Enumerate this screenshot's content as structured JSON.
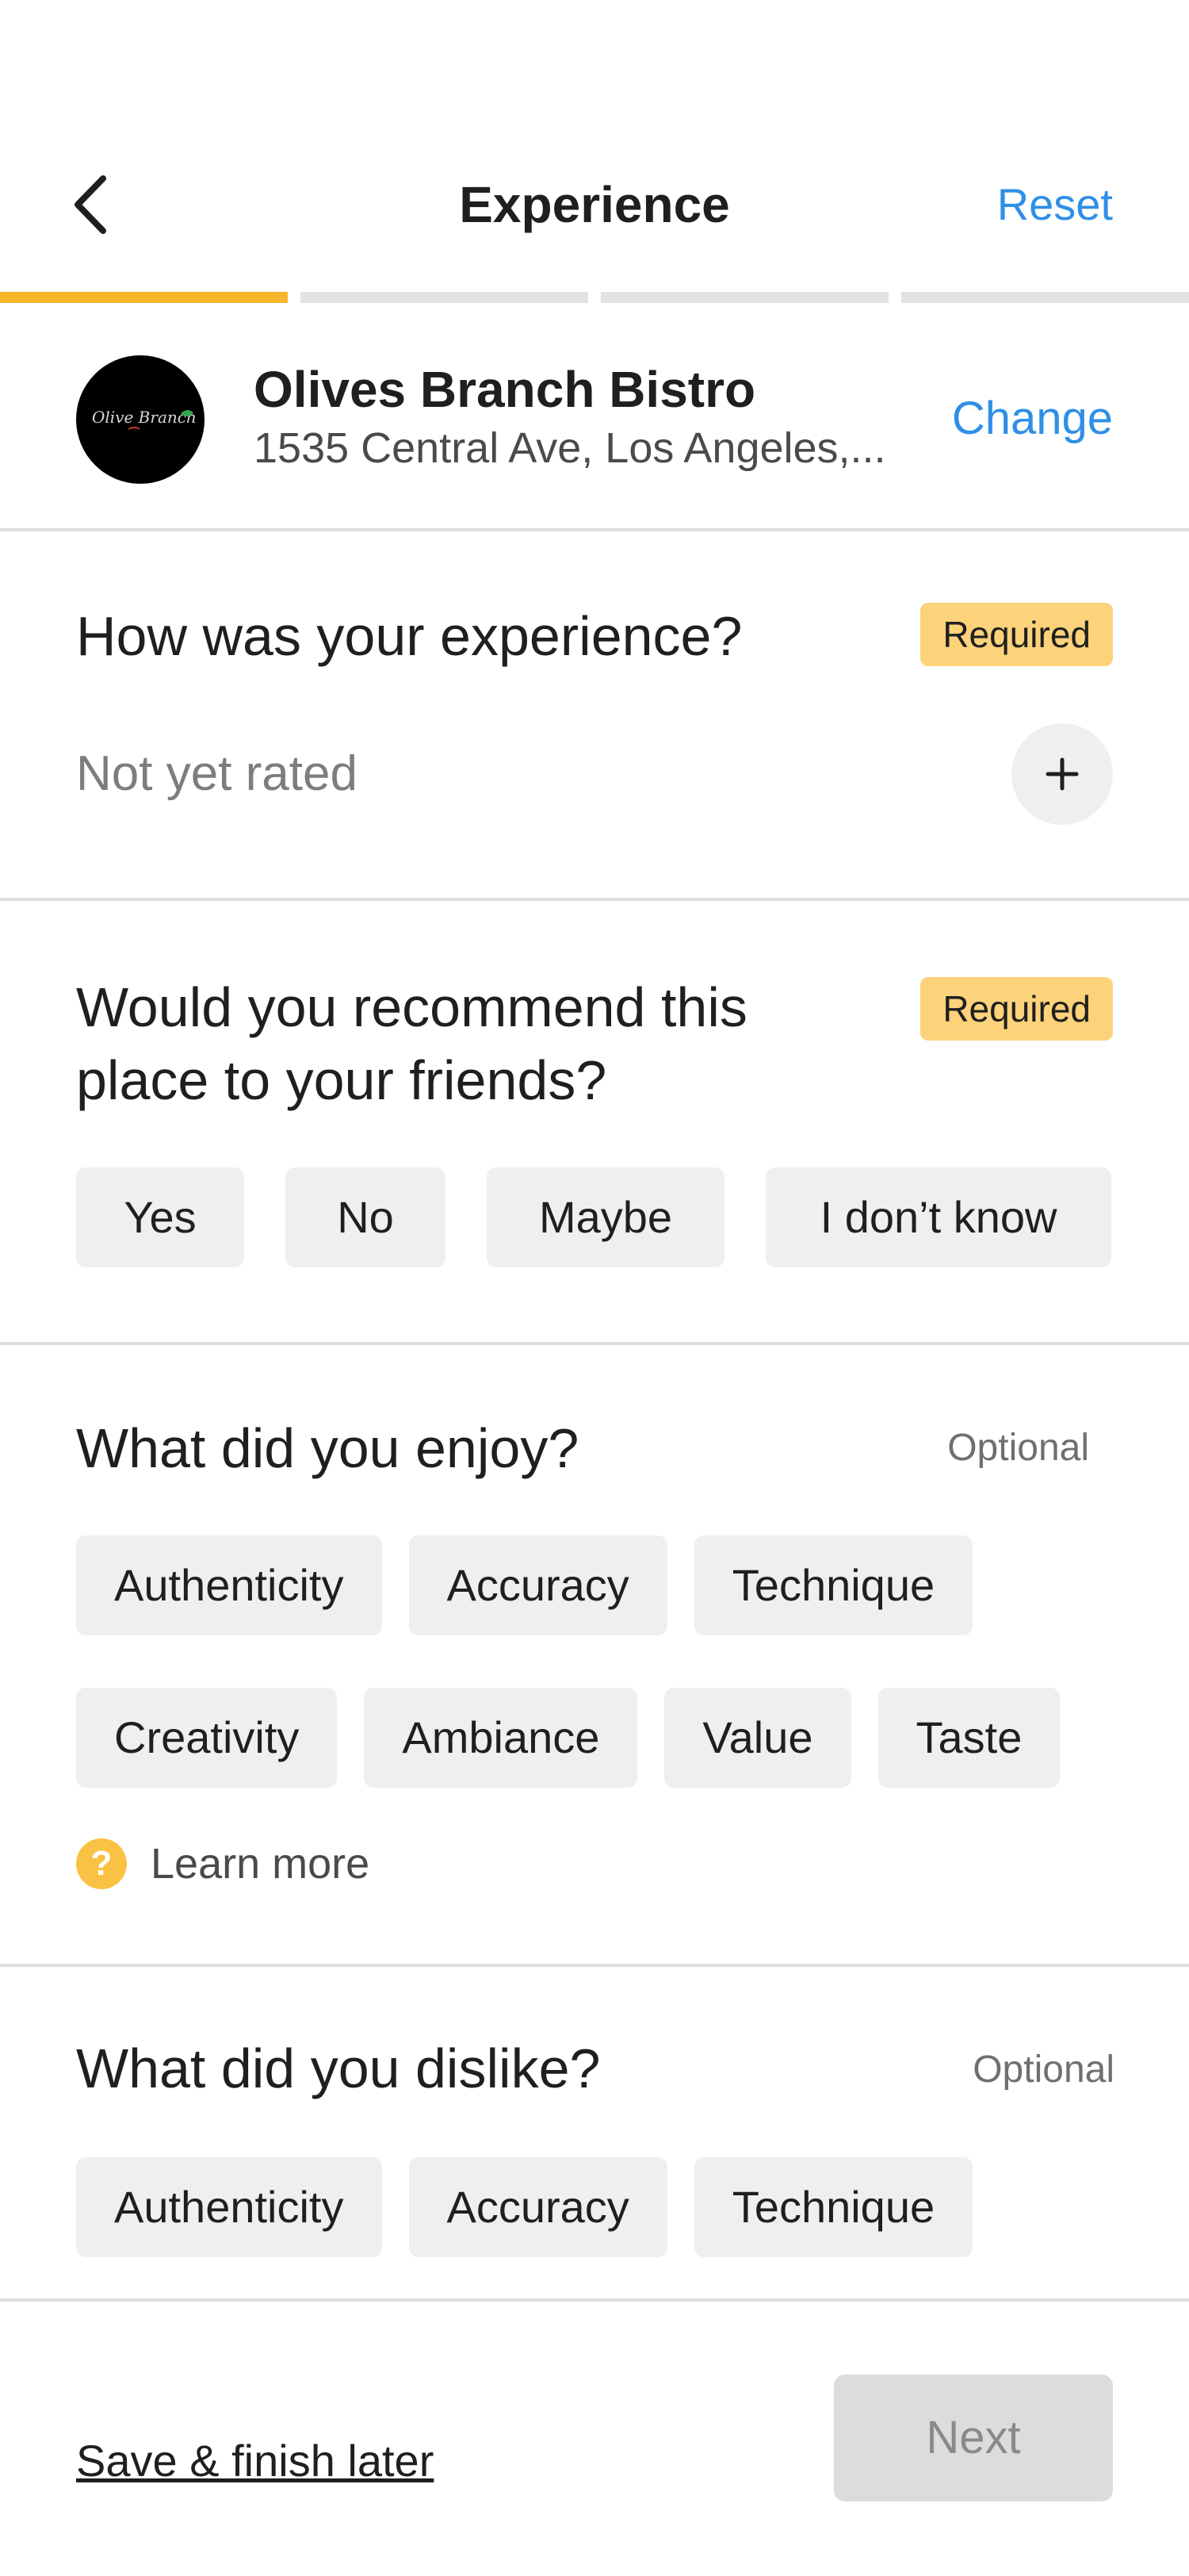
{
  "header": {
    "title": "Experience",
    "reset_label": "Reset",
    "back_icon": "chevron-left-icon"
  },
  "progress": {
    "total_steps": 4,
    "current_step": 1,
    "active_color": "#f7b52c"
  },
  "restaurant": {
    "name": "Olives Branch Bistro",
    "address": "1535 Central Ave, Los Angeles,...",
    "change_label": "Change",
    "logo_text": "Olive Branch"
  },
  "experience": {
    "question": "How was your experience?",
    "badge": "Required",
    "status": "Not yet rated"
  },
  "recommend": {
    "question": "Would you recommend this place to your friends?",
    "badge": "Required",
    "options": [
      "Yes",
      "No",
      "Maybe",
      "I don’t know"
    ]
  },
  "enjoy": {
    "question": "What did you enjoy?",
    "badge": "Optional",
    "tags": [
      "Authenticity",
      "Accuracy",
      "Technique",
      "Creativity",
      "Ambiance",
      "Value",
      "Taste"
    ],
    "learn_more": "Learn more"
  },
  "dislike": {
    "question": "What did you dislike?",
    "badge": "Optional",
    "tags": [
      "Authenticity",
      "Accuracy",
      "Technique"
    ]
  },
  "footer": {
    "save_label": "Save & finish later",
    "next_label": "Next"
  },
  "colors": {
    "accent": "#2f8fe6",
    "required_badge": "#fcd27a",
    "chip_bg": "#efefef",
    "disabled_button": "#dcdcdc"
  }
}
